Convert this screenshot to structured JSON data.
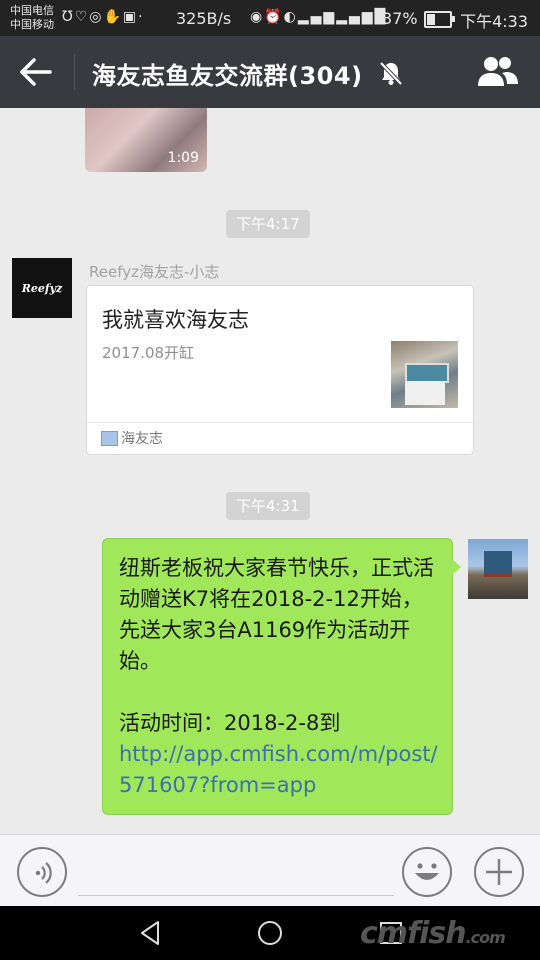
{
  "status_bar": {
    "carrier_1": "中国电信",
    "carrier_2": "中国移动",
    "net_speed": "325B/s",
    "battery_pct": "37%",
    "battery_level": 0.37,
    "time": "下午4:33"
  },
  "header": {
    "title": "海友志鱼友交流群(304)"
  },
  "messages": {
    "video": {
      "duration": "1:09"
    },
    "timestamp_1": "下午4:17",
    "link_card": {
      "sender": "Reefyz海友志-小志",
      "avatar_text": "Reefyz",
      "title": "我就喜欢海友志",
      "desc": "2017.08开缸",
      "source": "海友志"
    },
    "timestamp_2": "下午4:31",
    "outgoing": {
      "line_1": "纽斯老板祝大家春节快乐，正式活动赠送K7将在2018-2-12开始，先送大家3台A1169作为活动开始。",
      "line_2": "活动时间：2018-2-8到",
      "link": "http://app.cmfish.com/m/post/571607?from=app"
    }
  },
  "watermark": {
    "main": "cmfish",
    "suffix": ".com"
  },
  "colors": {
    "header_bg": "#393a3f",
    "bubble_green": "#a1e75a",
    "link_blue": "#3e6fb0"
  }
}
